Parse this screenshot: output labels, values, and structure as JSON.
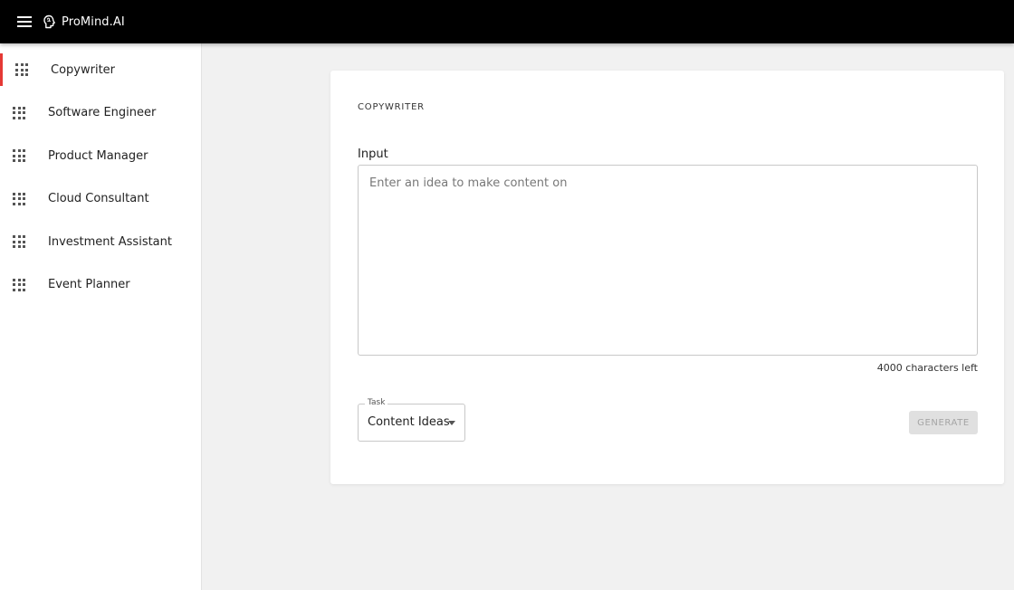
{
  "app": {
    "brand": "ProMind.AI"
  },
  "sidebar": {
    "items": [
      {
        "label": "Copywriter"
      },
      {
        "label": "Software Engineer"
      },
      {
        "label": "Product Manager"
      },
      {
        "label": "Cloud Consultant"
      },
      {
        "label": "Investment Assistant"
      },
      {
        "label": "Event Planner"
      }
    ]
  },
  "main": {
    "title": "COPYWRITER",
    "input_label": "Input",
    "input_placeholder": "Enter an idea to make content on",
    "input_value": "",
    "char_count": "4000 characters left",
    "task_label": "Task",
    "task_value": "Content Ideas",
    "generate_label": "GENERATE"
  },
  "colors": {
    "accent": "#e53935",
    "topbar": "#000000"
  }
}
